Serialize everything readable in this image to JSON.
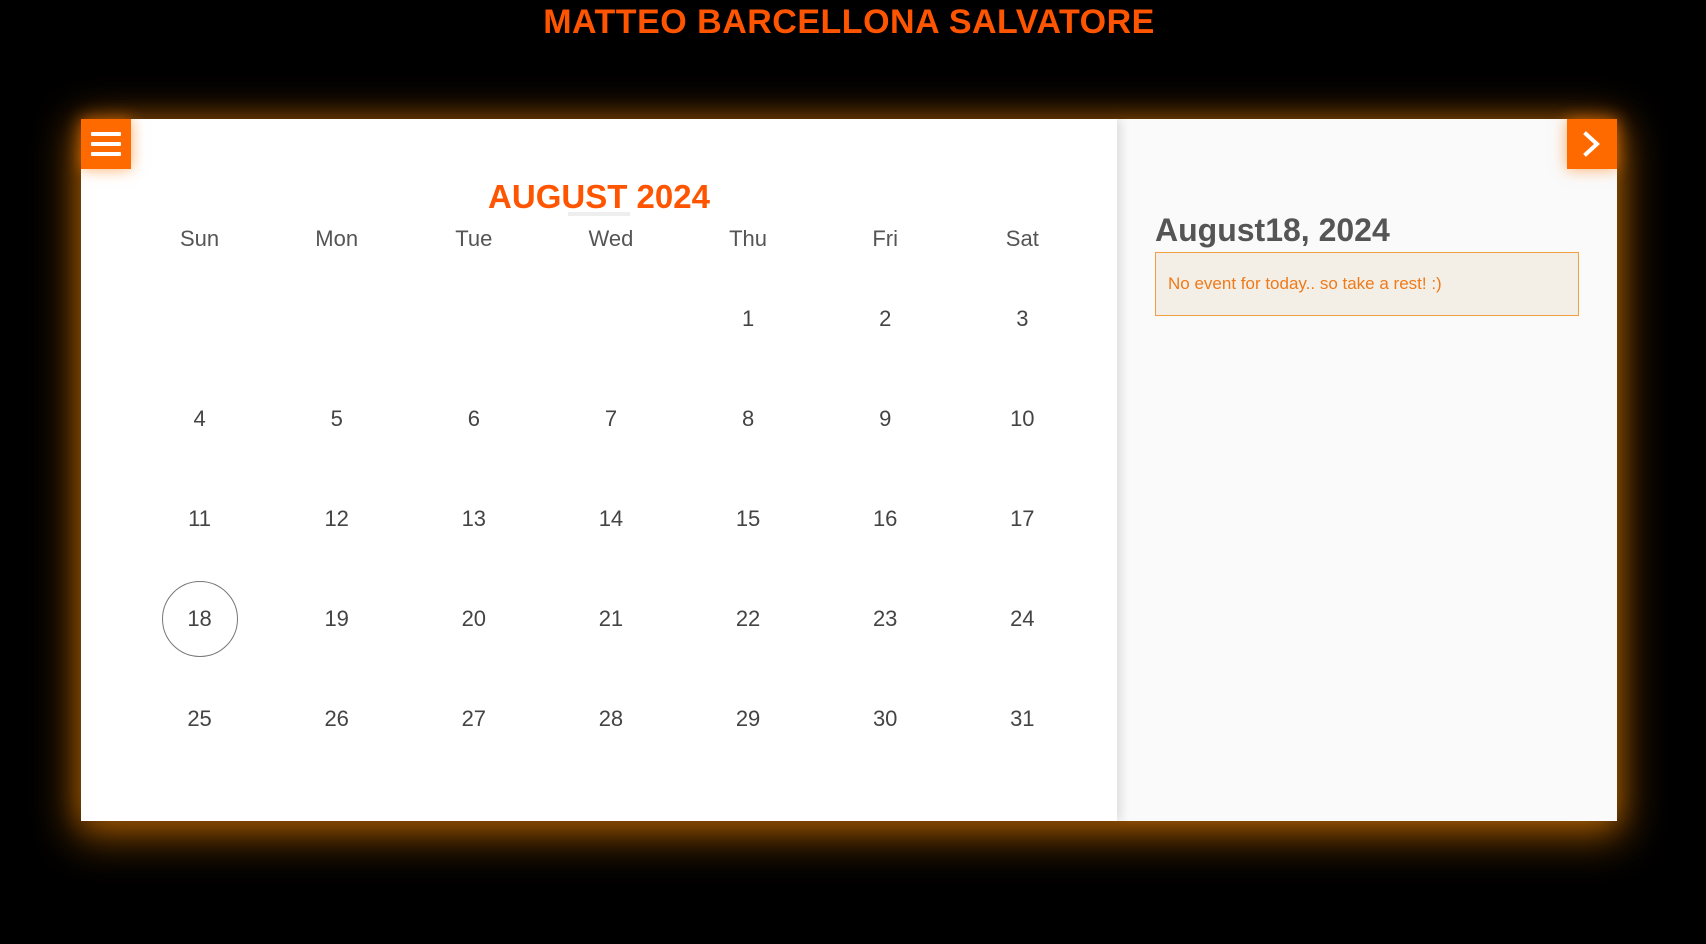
{
  "header": {
    "title": "MATTEO BARCELLONA SALVATORE"
  },
  "calendar": {
    "month_title": "AUGUST 2024",
    "menu_icon": "hamburger-menu-icon",
    "next_icon": "chevron-right-icon",
    "weekdays": [
      "Sun",
      "Mon",
      "Tue",
      "Wed",
      "Thu",
      "Fri",
      "Sat"
    ],
    "leading_blank_days": 4,
    "days": [
      "1",
      "2",
      "3",
      "4",
      "5",
      "6",
      "7",
      "8",
      "9",
      "10",
      "11",
      "12",
      "13",
      "14",
      "15",
      "16",
      "17",
      "18",
      "19",
      "20",
      "21",
      "22",
      "23",
      "24",
      "25",
      "26",
      "27",
      "28",
      "29",
      "30",
      "31"
    ],
    "selected_day": "18"
  },
  "sidebar": {
    "selected_date": "August18, 2024",
    "event_message": "No event for today.. so take a rest! :)"
  },
  "colors": {
    "accent": "#ff6a00",
    "title": "#ff5500",
    "text": "#555555",
    "event_bg": "#f4efe6",
    "event_border": "#f0a040",
    "event_text": "#ee7a1a"
  }
}
